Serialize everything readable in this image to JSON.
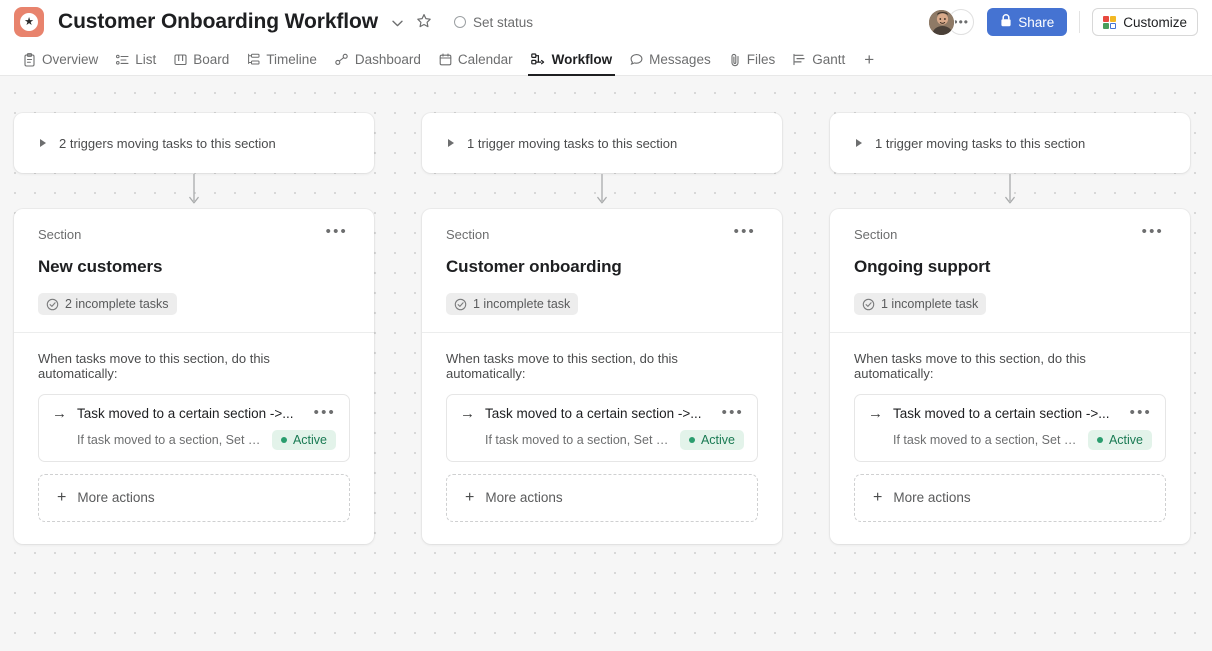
{
  "header": {
    "app_icon": "star-icon",
    "project_title": "Customer Onboarding Workflow",
    "chevron": "⌄",
    "star": "☆",
    "set_status_label": "Set status",
    "avatar_more": "•••",
    "share_label": "Share",
    "customize_label": "Customize",
    "accent_blue": "#4573d2",
    "icon_orange": "#e8836d",
    "customize_colors": [
      "#e8483f",
      "#f2b824",
      "#4a9d5b",
      "#4573d2"
    ]
  },
  "tabs": [
    {
      "label": "Overview",
      "icon": "clipboard-icon",
      "active": false
    },
    {
      "label": "List",
      "icon": "list-icon",
      "active": false
    },
    {
      "label": "Board",
      "icon": "board-icon",
      "active": false
    },
    {
      "label": "Timeline",
      "icon": "timeline-icon",
      "active": false
    },
    {
      "label": "Dashboard",
      "icon": "dashboard-icon",
      "active": false
    },
    {
      "label": "Calendar",
      "icon": "calendar-icon",
      "active": false
    },
    {
      "label": "Workflow",
      "icon": "workflow-icon",
      "active": true
    },
    {
      "label": "Messages",
      "icon": "message-icon",
      "active": false
    },
    {
      "label": "Files",
      "icon": "paperclip-icon",
      "active": false
    },
    {
      "label": "Gantt",
      "icon": "gantt-icon",
      "active": false
    }
  ],
  "tab_add_label": "+",
  "columns": [
    {
      "trigger_text": "2 triggers moving tasks to this section",
      "section_label": "Section",
      "section_title": "New customers",
      "incomplete_badge": "2 incomplete tasks",
      "automation_label": "When tasks move to this section, do this automatically:",
      "rule_title": "Task moved to a certain section ->...",
      "rule_subtitle": "If task moved to a section, Set Im...",
      "rule_status": "Active",
      "more_actions_label": "More actions",
      "dots": "•••",
      "arrow": "→",
      "plus": "+"
    },
    {
      "trigger_text": "1 trigger moving tasks to this section",
      "section_label": "Section",
      "section_title": "Customer onboarding",
      "incomplete_badge": "1 incomplete task",
      "automation_label": "When tasks move to this section, do this automatically:",
      "rule_title": "Task moved to a certain section ->...",
      "rule_subtitle": "If task moved to a section, Set Im...",
      "rule_status": "Active",
      "more_actions_label": "More actions",
      "dots": "•••",
      "arrow": "→",
      "plus": "+"
    },
    {
      "trigger_text": "1 trigger moving tasks to this section",
      "section_label": "Section",
      "section_title": "Ongoing support",
      "incomplete_badge": "1 incomplete task",
      "automation_label": "When tasks move to this section, do this automatically:",
      "rule_title": "Task moved to a certain section ->...",
      "rule_subtitle": "If task moved to a section, Set Im...",
      "rule_status": "Active",
      "more_actions_label": "More actions",
      "dots": "•••",
      "arrow": "→",
      "plus": "+"
    }
  ]
}
